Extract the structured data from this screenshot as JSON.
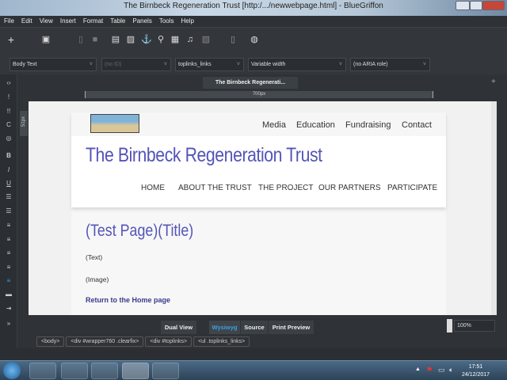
{
  "window": {
    "title": "The Birnbeck Regeneration Trust [http:/.../newwebpage.html] - BlueGriffon"
  },
  "menu": [
    "File",
    "Edit",
    "View",
    "Insert",
    "Format",
    "Table",
    "Panels",
    "Tools",
    "Help"
  ],
  "format_bar": {
    "paragraph": "Body Text",
    "id": "(no ID)",
    "class": "toplinks_links",
    "width": "Variable width",
    "aria": "(no ARIA role)"
  },
  "tab": {
    "label": "The Birnbeck Regenerati..."
  },
  "ruler": {
    "width_label": "700px",
    "height_label": "51px"
  },
  "page": {
    "toplinks": [
      "Media",
      "Education",
      "Fundraising",
      "Contact"
    ],
    "site_title": "The Birnbeck Regeneration Trust",
    "nav": [
      "HOME",
      "ABOUT THE TRUST",
      "THE PROJECT",
      "OUR PARTNERS",
      "PARTICIPATE"
    ],
    "page_title": "(Test Page)(Title)",
    "text": "(Text)",
    "image": "(Image)",
    "home_link": "Return to the Home page"
  },
  "view_buttons": {
    "dual": "Dual View",
    "wysiwyg": "Wysiwyg",
    "source": "Source",
    "print": "Print Preview"
  },
  "zoom": "100%",
  "breadcrumbs": [
    "<body>",
    "<div #wrapper760 .clearfix>",
    "<div #toplinks>",
    "<ul .toplinks_links>"
  ],
  "taskbar": {
    "time": "17:51",
    "date": "24/12/2017"
  },
  "colors": {
    "accent": "#5454b8",
    "active_view": "#3ba0e0"
  }
}
